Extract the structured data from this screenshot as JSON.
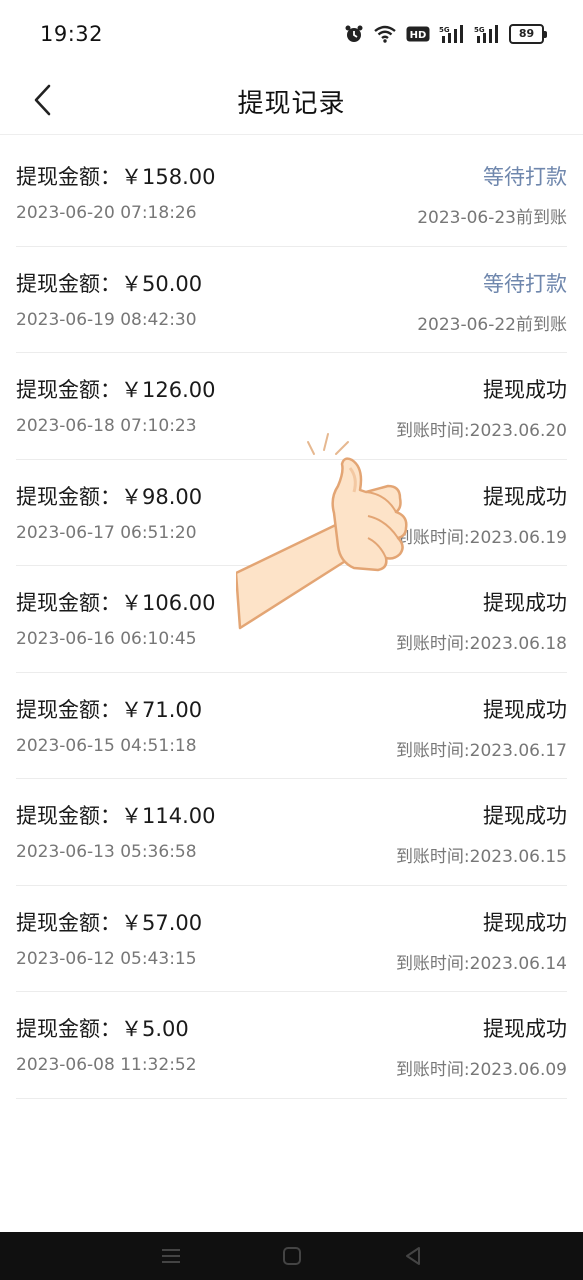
{
  "status_bar": {
    "time": "19:32",
    "hd_label": "HD",
    "signal1_label": "5G",
    "signal2_label": "5G",
    "battery": "89"
  },
  "nav": {
    "title": "提现记录"
  },
  "records": [
    {
      "amount": "提现金额：￥158.00",
      "status": "等待打款",
      "time": "2023-06-20 07:18:26",
      "arrival": "2023-06-23前到账",
      "pending": true
    },
    {
      "amount": "提现金额：￥50.00",
      "status": "等待打款",
      "time": "2023-06-19 08:42:30",
      "arrival": "2023-06-22前到账",
      "pending": true
    },
    {
      "amount": "提现金额：￥126.00",
      "status": "提现成功",
      "time": "2023-06-18 07:10:23",
      "arrival": "到账时间:2023.06.20",
      "pending": false
    },
    {
      "amount": "提现金额：￥98.00",
      "status": "提现成功",
      "time": "2023-06-17 06:51:20",
      "arrival": "到账时间:2023.06.19",
      "pending": false
    },
    {
      "amount": "提现金额：￥106.00",
      "status": "提现成功",
      "time": "2023-06-16 06:10:45",
      "arrival": "到账时间:2023.06.18",
      "pending": false
    },
    {
      "amount": "提现金额：￥71.00",
      "status": "提现成功",
      "time": "2023-06-15 04:51:18",
      "arrival": "到账时间:2023.06.17",
      "pending": false
    },
    {
      "amount": "提现金额：￥114.00",
      "status": "提现成功",
      "time": "2023-06-13 05:36:58",
      "arrival": "到账时间:2023.06.15",
      "pending": false
    },
    {
      "amount": "提现金额：￥57.00",
      "status": "提现成功",
      "time": "2023-06-12 05:43:15",
      "arrival": "到账时间:2023.06.14",
      "pending": false
    },
    {
      "amount": "提现金额：￥5.00",
      "status": "提现成功",
      "time": "2023-06-08 11:32:52",
      "arrival": "到账时间:2023.06.09",
      "pending": false
    }
  ],
  "colors": {
    "pending_status": "#6f87ad",
    "success_status": "#1a1a1a",
    "secondary_text": "#777777"
  },
  "icons": {
    "back": "chevron-left-icon",
    "sticker": "thumbs-up-icon",
    "nav_menu": "menu-icon",
    "nav_home": "home-icon",
    "nav_back": "back-triangle-icon"
  }
}
